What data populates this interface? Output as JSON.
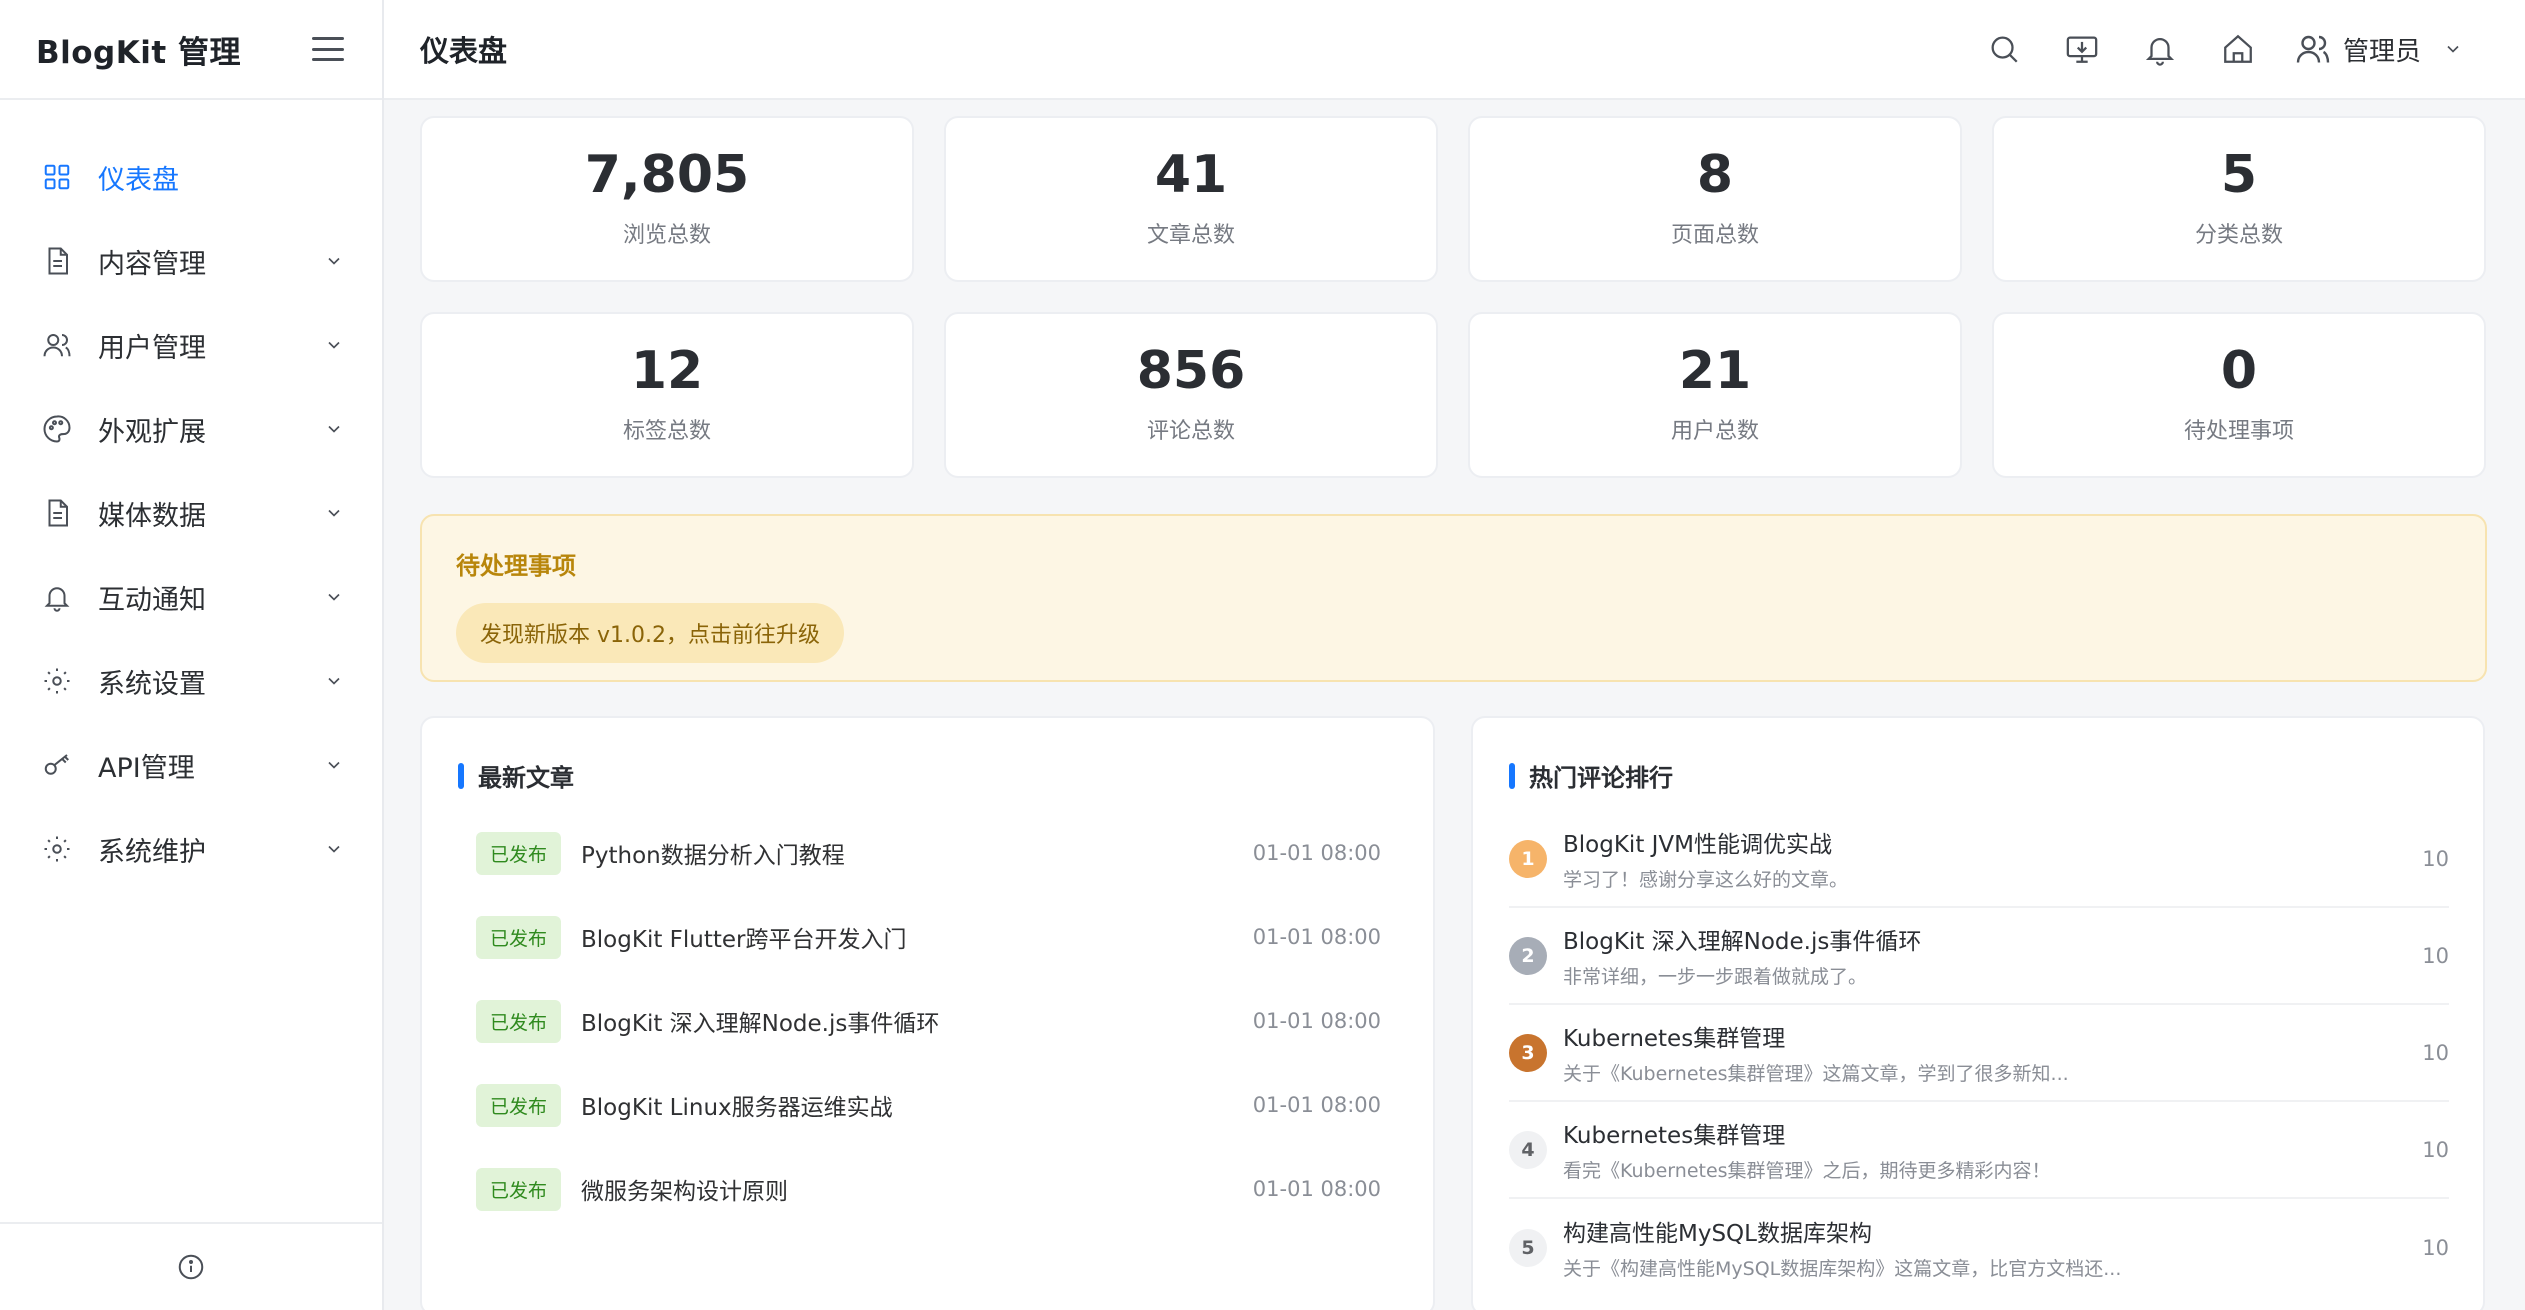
{
  "sidebar": {
    "brand": "BlogKit 管理",
    "items": [
      {
        "label": "仪表盘",
        "icon": "grid-icon"
      },
      {
        "label": "内容管理",
        "icon": "document-icon"
      },
      {
        "label": "用户管理",
        "icon": "users-icon"
      },
      {
        "label": "外观扩展",
        "icon": "palette-icon"
      },
      {
        "label": "媒体数据",
        "icon": "file-icon"
      },
      {
        "label": "互动通知",
        "icon": "bell-icon"
      },
      {
        "label": "系统设置",
        "icon": "settings-icon"
      },
      {
        "label": "API管理",
        "icon": "key-icon"
      },
      {
        "label": "系统维护",
        "icon": "maintenance-icon"
      }
    ]
  },
  "header": {
    "title": "仪表盘",
    "user_name": "管理员"
  },
  "stats": [
    {
      "value": "7,805",
      "label": "浏览总数"
    },
    {
      "value": "41",
      "label": "文章总数"
    },
    {
      "value": "8",
      "label": "页面总数"
    },
    {
      "value": "5",
      "label": "分类总数"
    },
    {
      "value": "12",
      "label": "标签总数"
    },
    {
      "value": "856",
      "label": "评论总数"
    },
    {
      "value": "21",
      "label": "用户总数"
    },
    {
      "value": "0",
      "label": "待处理事项"
    }
  ],
  "pending": {
    "title": "待处理事项",
    "tag": "发现新版本 v1.0.2，点击前往升级"
  },
  "latest_posts": {
    "title": "最新文章",
    "items": [
      {
        "status": "已发布",
        "title": "Python数据分析入门教程",
        "time": "01-01 08:00"
      },
      {
        "status": "已发布",
        "title": "BlogKit Flutter跨平台开发入门",
        "time": "01-01 08:00"
      },
      {
        "status": "已发布",
        "title": "BlogKit 深入理解Node.js事件循环",
        "time": "01-01 08:00"
      },
      {
        "status": "已发布",
        "title": "BlogKit Linux服务器运维实战",
        "time": "01-01 08:00"
      },
      {
        "status": "已发布",
        "title": "微服务架构设计原则",
        "time": "01-01 08:00"
      }
    ]
  },
  "hot_comments": {
    "title": "热门评论排行",
    "items": [
      {
        "rank": "1",
        "title": "BlogKit JVM性能调优实战",
        "desc": "学习了！感谢分享这么好的文章。",
        "count": "10"
      },
      {
        "rank": "2",
        "title": "BlogKit 深入理解Node.js事件循环",
        "desc": "非常详细，一步一步跟着做就成了。",
        "count": "10"
      },
      {
        "rank": "3",
        "title": "Kubernetes集群管理",
        "desc": "关于《Kubernetes集群管理》这篇文章，学到了很多新知...",
        "count": "10"
      },
      {
        "rank": "4",
        "title": "Kubernetes集群管理",
        "desc": "看完《Kubernetes集群管理》之后，期待更多精彩内容！",
        "count": "10"
      },
      {
        "rank": "5",
        "title": "构建高性能MySQL数据库架构",
        "desc": "关于《构建高性能MySQL数据库架构》这篇文章，比官方文档还...",
        "count": "10"
      }
    ]
  },
  "colors": {
    "accent": "#1677ff",
    "rank1": "#f6b46a",
    "rank2": "#a7adb7",
    "rank3": "#c8742e"
  }
}
